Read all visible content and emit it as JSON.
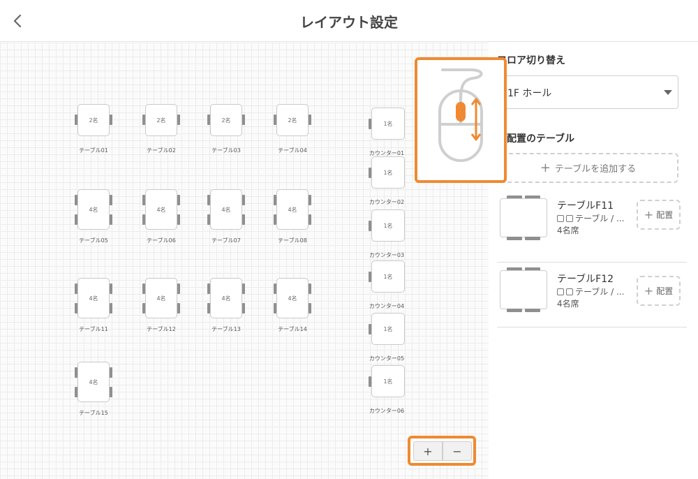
{
  "header": {
    "title": "レイアウト設定"
  },
  "canvas": {
    "tables": [
      {
        "seats": "2名",
        "label": "テーブル01"
      },
      {
        "seats": "2名",
        "label": "テーブル02"
      },
      {
        "seats": "2名",
        "label": "テーブル03"
      },
      {
        "seats": "2名",
        "label": "テーブル04"
      },
      {
        "seats": "4名",
        "label": "テーブル05"
      },
      {
        "seats": "4名",
        "label": "テーブル06"
      },
      {
        "seats": "4名",
        "label": "テーブル07"
      },
      {
        "seats": "4名",
        "label": "テーブル08"
      },
      {
        "seats": "4名",
        "label": "テーブル11"
      },
      {
        "seats": "4名",
        "label": "テーブル12"
      },
      {
        "seats": "4名",
        "label": "テーブル13"
      },
      {
        "seats": "4名",
        "label": "テーブル14"
      },
      {
        "seats": "4名",
        "label": "テーブル15"
      }
    ],
    "counters": [
      {
        "seats": "1名",
        "label": "カウンター01"
      },
      {
        "seats": "1名",
        "label": "カウンター02"
      },
      {
        "seats": "1名",
        "label": "カウンター03"
      },
      {
        "seats": "1名",
        "label": "カウンター04"
      },
      {
        "seats": "1名",
        "label": "カウンター05"
      },
      {
        "seats": "1名",
        "label": "カウンター06"
      }
    ]
  },
  "panel": {
    "floor_title": "フロア切り替え",
    "floor_value": "1F ホール",
    "unplaced_title": "未配置のテーブル",
    "add_table_label": "テーブルを追加する",
    "items": [
      {
        "name": "テーブルF11",
        "type": "テーブル / ...",
        "seats": "4名席",
        "place_label": "配置"
      },
      {
        "name": "テーブルF12",
        "type": "テーブル / ...",
        "seats": "4名席",
        "place_label": "配置"
      }
    ]
  },
  "zoom": {
    "in_label": "+",
    "out_label": "−"
  },
  "colors": {
    "accent": "#ef8a32",
    "chair": "#8f8f8f"
  }
}
